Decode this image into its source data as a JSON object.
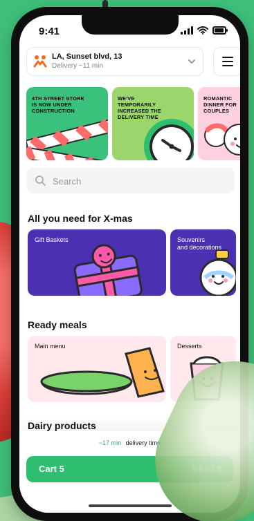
{
  "status_bar": {
    "time": "9:41"
  },
  "header": {
    "address_title": "LA, Sunset blvd, 13",
    "address_sub": "Delivery ~11 min"
  },
  "banners": [
    {
      "text": "4TH STREET STORE\nIS NOW UNDER\nCONSTRUCTION"
    },
    {
      "text": "WE'VE\nTEMPORARILY\nINCREASED THE\nDELIVERY TIME"
    },
    {
      "text": "ROMANTIC\nDINNER FOR\nCOUPLES"
    }
  ],
  "search": {
    "placeholder": "Search"
  },
  "sections": {
    "xmas_title": "All you need for X-mas",
    "xmas_cards": [
      {
        "label": "Gift Baskets"
      },
      {
        "label": "Souvenirs\nand decorations"
      }
    ],
    "ready_meals_title": "Ready meals",
    "ready_meals_cards": [
      {
        "label": "Main menu"
      },
      {
        "label": "Desserts"
      }
    ],
    "dairy_title": "Dairy products"
  },
  "bottom_bar": {
    "delivery_time_value": "~17 min",
    "delivery_time_text": "delivery time",
    "cart_label": "Cart 5",
    "cart_total": "54.67 $"
  },
  "colors": {
    "background_green": "#3fbf7a",
    "accent_green": "#2fbe6f",
    "brand_orange": "#f36b21",
    "banner1": "#3ac17b",
    "banner2": "#9ad66b",
    "banner3": "#ffd0df",
    "xmas_purple": "#4b31b1",
    "ready_pink": "#ffe9ec"
  },
  "icons": {
    "brand": "brand-logo-icon",
    "chevron": "chevron-down-icon",
    "menu": "menu-icon",
    "search": "search-icon"
  }
}
